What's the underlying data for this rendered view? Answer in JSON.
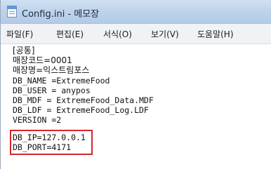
{
  "window": {
    "title": "Config.ini - 메모장"
  },
  "menu": {
    "items": [
      {
        "label": "파일(F)"
      },
      {
        "label": "편집(E)"
      },
      {
        "label": "서식(O)"
      },
      {
        "label": "보기(V)"
      },
      {
        "label": "도움말(H)"
      }
    ]
  },
  "content": {
    "lines": [
      "[공통]",
      "매장코드=0001",
      "매장명=익스트림포스",
      "DB_NAME =ExtremeFood",
      "DB_USER = anypos",
      "DB_MDF = ExtremeFood_Data.MDF",
      "DB_LDF = ExtremeFood_Log.LDF",
      "VERSION =2",
      "DB_IP=127.0.0.1",
      "DB_PORT=4171"
    ]
  },
  "colors": {
    "highlight": "#d8262c",
    "titlebar": "#bcd2ea"
  },
  "icons": {
    "app": "notepad-icon"
  }
}
